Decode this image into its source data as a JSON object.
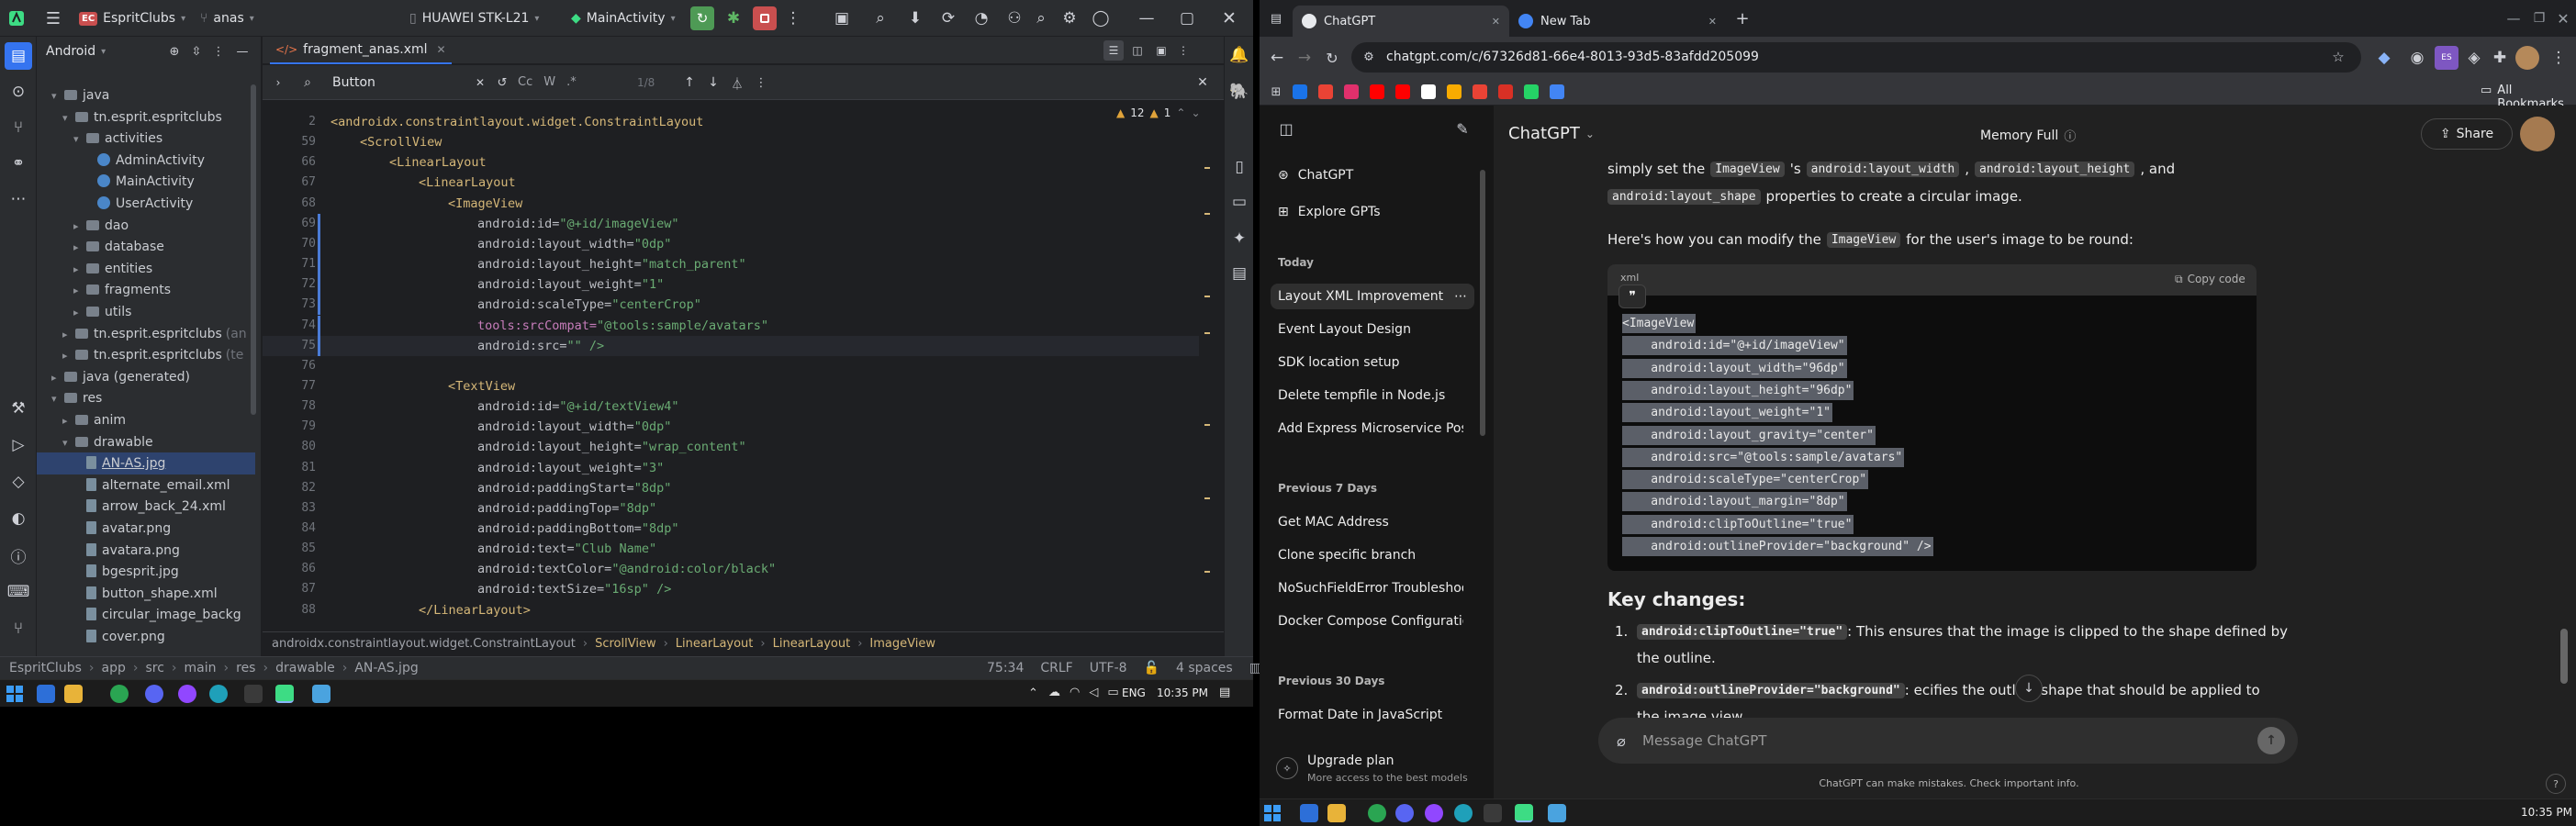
{
  "android_studio": {
    "view_mode": "Android",
    "project_badge": "EC",
    "project_name": "EspritClubs",
    "branch": "anas",
    "device": "HUAWEI STK-L21",
    "run_config": "MainActivity",
    "editor_tab": "fragment_anas.xml",
    "find_query": "Button",
    "find_options": [
      "Cc",
      "W",
      ".*"
    ],
    "find_result": "1/8",
    "inspection_errors": "12",
    "inspection_warnings": "1",
    "project_tree": [
      {
        "label": "java",
        "type": "folder",
        "indent": 1,
        "arrow": "▾"
      },
      {
        "label": "tn.esprit.espritclubs",
        "type": "folder",
        "indent": 2,
        "arrow": "▾"
      },
      {
        "label": "activities",
        "type": "folder",
        "indent": 3,
        "arrow": "▾"
      },
      {
        "label": "AdminActivity",
        "type": "class",
        "indent": 4,
        "arrow": ""
      },
      {
        "label": "MainActivity",
        "type": "class",
        "indent": 4,
        "arrow": ""
      },
      {
        "label": "UserActivity",
        "type": "class",
        "indent": 4,
        "arrow": ""
      },
      {
        "label": "dao",
        "type": "folder",
        "indent": 3,
        "arrow": "▸"
      },
      {
        "label": "database",
        "type": "folder",
        "indent": 3,
        "arrow": "▸"
      },
      {
        "label": "entities",
        "type": "folder",
        "indent": 3,
        "arrow": "▸"
      },
      {
        "label": "fragments",
        "type": "folder",
        "indent": 3,
        "arrow": "▸"
      },
      {
        "label": "utils",
        "type": "folder",
        "indent": 3,
        "arrow": "▸"
      },
      {
        "label": "tn.esprit.espritclubs",
        "type": "folder",
        "indent": 2,
        "arrow": "▸",
        "suffix": "(an"
      },
      {
        "label": "tn.esprit.espritclubs",
        "type": "folder",
        "indent": 2,
        "arrow": "▸",
        "suffix": "(te"
      },
      {
        "label": "java (generated)",
        "type": "folder",
        "indent": 1,
        "arrow": "▸"
      },
      {
        "label": "res",
        "type": "folder",
        "indent": 1,
        "arrow": "▾"
      },
      {
        "label": "anim",
        "type": "folder",
        "indent": 2,
        "arrow": "▸"
      },
      {
        "label": "drawable",
        "type": "folder",
        "indent": 2,
        "arrow": "▾"
      },
      {
        "label": "AN-AS.jpg",
        "type": "file",
        "indent": 3,
        "arrow": "",
        "selected": true
      },
      {
        "label": "alternate_email.xml",
        "type": "file",
        "indent": 3,
        "arrow": ""
      },
      {
        "label": "arrow_back_24.xml",
        "type": "file",
        "indent": 3,
        "arrow": ""
      },
      {
        "label": "avatar.png",
        "type": "file",
        "indent": 3,
        "arrow": ""
      },
      {
        "label": "avatara.png",
        "type": "file",
        "indent": 3,
        "arrow": ""
      },
      {
        "label": "bgesprit.jpg",
        "type": "file",
        "indent": 3,
        "arrow": ""
      },
      {
        "label": "button_shape.xml",
        "type": "file",
        "indent": 3,
        "arrow": ""
      },
      {
        "label": "circular_image_backg",
        "type": "file",
        "indent": 3,
        "arrow": ""
      },
      {
        "label": "cover.png",
        "type": "file",
        "indent": 3,
        "arrow": ""
      }
    ],
    "code_lines": [
      {
        "n": "2",
        "depth": 0,
        "t": "<androidx.constraintlayout.widget.ConstraintLayout",
        "k": "tag"
      },
      {
        "n": "59",
        "depth": 1,
        "t": "<ScrollView",
        "k": "tag"
      },
      {
        "n": "66",
        "depth": 2,
        "t": "<LinearLayout",
        "k": "tag"
      },
      {
        "n": "67",
        "depth": 3,
        "t": "<LinearLayout",
        "k": "tag"
      },
      {
        "n": "68",
        "depth": 4,
        "t": "<ImageView",
        "k": "tag"
      },
      {
        "n": "69",
        "depth": 5,
        "a": "android:id=",
        "v": "\"@+id/imageView\""
      },
      {
        "n": "70",
        "depth": 5,
        "a": "android:layout_width=",
        "v": "\"0dp\""
      },
      {
        "n": "71",
        "depth": 5,
        "a": "android:layout_height=",
        "v": "\"match_parent\""
      },
      {
        "n": "72",
        "depth": 5,
        "a": "android:layout_weight=",
        "v": "\"1\""
      },
      {
        "n": "73",
        "depth": 5,
        "a": "android:scaleType=",
        "v": "\"centerCrop\""
      },
      {
        "n": "74",
        "depth": 5,
        "a": "tools:srcCompat=",
        "v": "\"@tools:sample/avatars\""
      },
      {
        "n": "75",
        "depth": 5,
        "a": "android:src=",
        "v": "\"\" />"
      },
      {
        "n": "76",
        "depth": 0,
        "t": ""
      },
      {
        "n": "77",
        "depth": 4,
        "t": "<TextView",
        "k": "tag"
      },
      {
        "n": "78",
        "depth": 5,
        "a": "android:id=",
        "v": "\"@+id/textView4\""
      },
      {
        "n": "79",
        "depth": 5,
        "a": "android:layout_width=",
        "v": "\"0dp\""
      },
      {
        "n": "80",
        "depth": 5,
        "a": "android:layout_height=",
        "v": "\"wrap_content\""
      },
      {
        "n": "81",
        "depth": 5,
        "a": "android:layout_weight=",
        "v": "\"3\""
      },
      {
        "n": "82",
        "depth": 5,
        "a": "android:paddingStart=",
        "v": "\"8dp\""
      },
      {
        "n": "83",
        "depth": 5,
        "a": "android:paddingTop=",
        "v": "\"8dp\""
      },
      {
        "n": "84",
        "depth": 5,
        "a": "android:paddingBottom=",
        "v": "\"8dp\""
      },
      {
        "n": "85",
        "depth": 5,
        "a": "android:text=",
        "v": "\"Club Name\""
      },
      {
        "n": "86",
        "depth": 5,
        "a": "android:textColor=",
        "v": "\"@android:color/black\""
      },
      {
        "n": "87",
        "depth": 5,
        "a": "android:textSize=",
        "v": "\"16sp\" />"
      },
      {
        "n": "88",
        "depth": 3,
        "t": "</LinearLayout>",
        "k": "tag"
      }
    ],
    "editor_breadcrumb": [
      "androidx.constraintlayout.widget.ConstraintLayout",
      "ScrollView",
      "LinearLayout",
      "LinearLayout",
      "ImageView"
    ],
    "status_path": [
      "EspritClubs",
      "app",
      "src",
      "main",
      "res",
      "drawable",
      "AN-AS.jpg"
    ],
    "status_right": {
      "position": "75:34",
      "line_sep": "CRLF",
      "encoding": "UTF-8",
      "indent": "4 spaces"
    }
  },
  "chrome": {
    "tabs": [
      {
        "title": "ChatGPT",
        "active": true
      },
      {
        "title": "New Tab",
        "active": false
      }
    ],
    "url": "chatgpt.com/c/67326d81-66e4-8013-93d5-83afdd205099",
    "all_bookmarks": "All Bookmarks",
    "profile_badge": "ES",
    "bookmark_colors": [
      "#1a73e8",
      "#ea4335",
      "#e1306c",
      "#ff0000",
      "#ff0000",
      "#ffffff",
      "#f9ab00",
      "#ea4335",
      "#d93025",
      "#25d366",
      "#4285f4"
    ]
  },
  "gpt": {
    "sidebar": {
      "top": [
        {
          "label": "ChatGPT",
          "icon": "chatgpt-icon"
        },
        {
          "label": "Explore GPTs",
          "icon": "grid-icon"
        }
      ],
      "sections": [
        {
          "heading": "Today",
          "items": [
            "Layout XML Improvement",
            "Event Layout Design",
            "SDK location setup",
            "Delete tempfile in Node.js",
            "Add Express Microservice Postgr"
          ]
        },
        {
          "heading": "Previous 7 Days",
          "items": [
            "Get MAC Address",
            "Clone specific branch",
            "NoSuchFieldError Troubleshooti",
            "Docker Compose Configuration"
          ]
        },
        {
          "heading": "Previous 30 Days",
          "items": [
            "Format Date in JavaScript"
          ]
        }
      ],
      "upgrade_title": "Upgrade plan",
      "upgrade_subtitle": "More access to the best models"
    },
    "header": {
      "model": "ChatGPT",
      "memory": "Memory Full",
      "share": "Share"
    },
    "intro_partial": "simply set the",
    "intro_code1": "ImageView",
    "intro_mid": "'s",
    "intro_code2": "android:layout_width",
    "intro_code3": "android:layout_height",
    "intro_and": ", and",
    "line2_code": "android:layout_shape",
    "line2_text": "properties to create a circular image.",
    "para_pre": "Here's how you can modify the",
    "para_code": "ImageView",
    "para_post": "for the user's image to be round:",
    "code_lang": "xml",
    "copy_code": "Copy code",
    "code_lines": [
      "<ImageView",
      "    android:id=\"@+id/imageView\"",
      "    android:layout_width=\"96dp\"",
      "    android:layout_height=\"96dp\"",
      "    android:layout_weight=\"1\"",
      "    android:layout_gravity=\"center\"",
      "    android:src=\"@tools:sample/avatars\"",
      "    android:scaleType=\"centerCrop\"",
      "    android:layout_margin=\"8dp\"",
      "    android:clipToOutline=\"true\"",
      "    android:outlineProvider=\"background\" />"
    ],
    "key_changes_title": "Key changes:",
    "changes": [
      {
        "n": "1.",
        "code": "android:clipToOutline=\"true\"",
        "text": ": This ensures that the image is clipped to the shape defined by",
        "text2": "the outline."
      },
      {
        "n": "2.",
        "code": "android:outlineProvider=\"background\"",
        "text": ": ecifies the outline shape that should be applied to",
        "text2": "the image view."
      }
    ],
    "input_placeholder": "Message ChatGPT",
    "disclaimer": "ChatGPT can make mistakes. Check important info."
  },
  "taskbar": {
    "left": {
      "lang": "ENG",
      "time": "10:35 PM"
    },
    "right": {
      "time": "10:35 PM"
    }
  }
}
